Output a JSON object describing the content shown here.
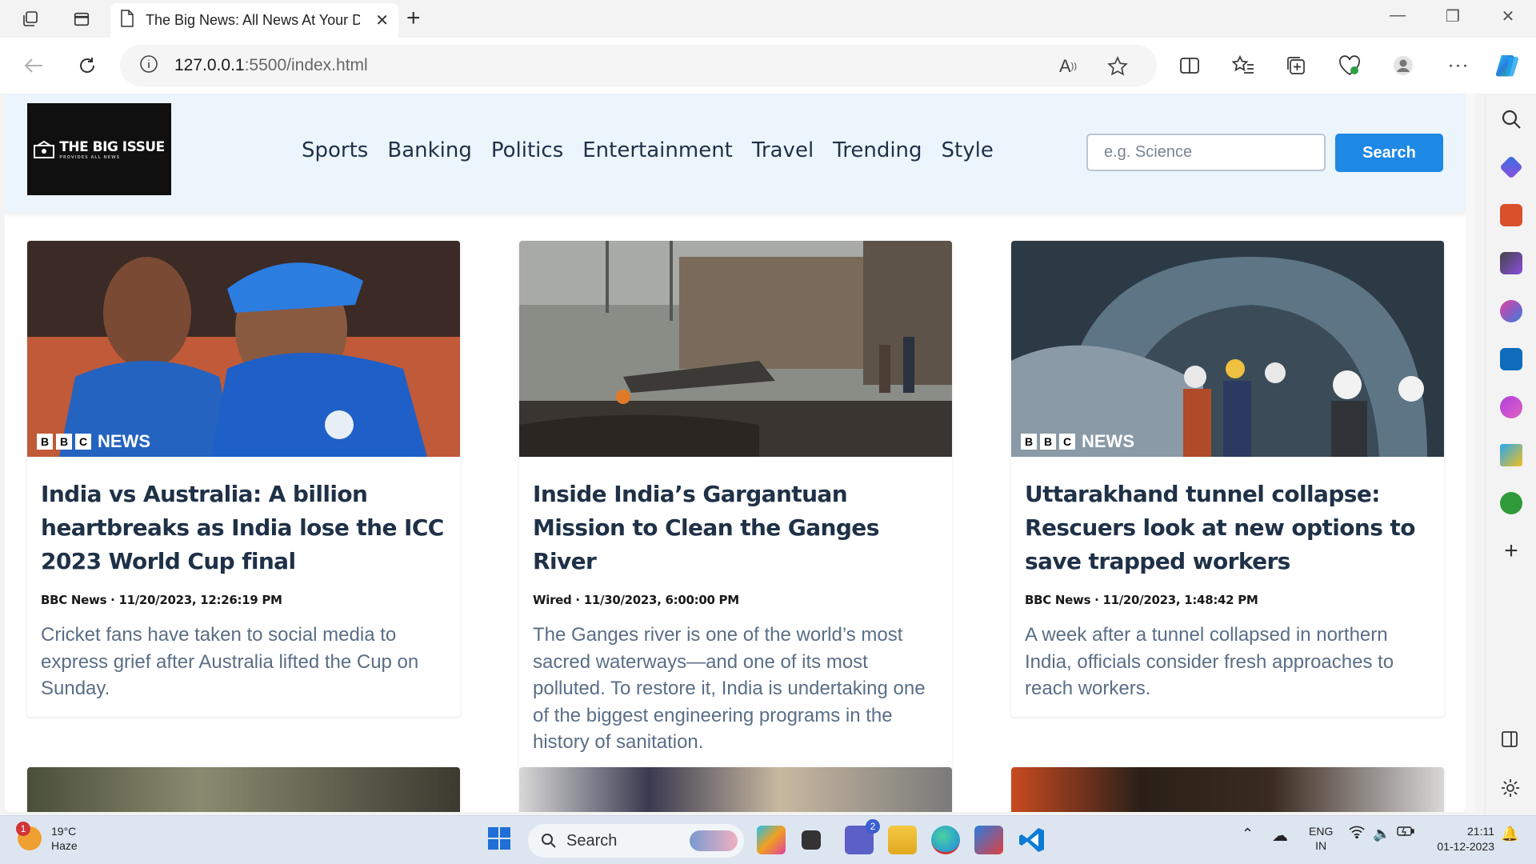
{
  "browser": {
    "tab_title": "The Big News: All News At Your D",
    "url_host": "127.0.0.1",
    "url_rest": ":5500/index.html"
  },
  "site": {
    "logo_text": "THE BIG ISSUE",
    "logo_sub": "PROVIDES ALL NEWS",
    "nav": [
      "Sports",
      "Banking",
      "Politics",
      "Entertainment",
      "Travel",
      "Trending",
      "Style"
    ],
    "search_placeholder": "e.g. Science",
    "search_button": "Search"
  },
  "articles": [
    {
      "title": "India vs Australia: A billion heartbreaks as India lose the ICC 2023 World Cup final",
      "meta": "BBC News · 11/20/2023, 12:26:19 PM",
      "description": "Cricket fans have taken to social media to express grief after Australia lifted the Cup on Sunday.",
      "badge": "NEWS",
      "image_colors": [
        "#2b5fb0",
        "#c2563a",
        "#1d3f86"
      ]
    },
    {
      "title": "Inside India’s Gargantuan Mission to Clean the Ganges River",
      "meta": "Wired · 11/30/2023, 6:00:00 PM",
      "description": "The Ganges river is one of the world’s most sacred waterways—and one of its most polluted. To restore it, India is undertaking one of the biggest engineering programs in the history of sanitation.",
      "badge": "",
      "image_colors": [
        "#9a9a98",
        "#6b6e6a",
        "#3e3b36"
      ]
    },
    {
      "title": "Uttarakhand tunnel collapse: Rescuers look at new options to save trapped workers",
      "meta": "BBC News · 11/20/2023, 1:48:42 PM",
      "description": "A week after a tunnel collapsed in northern India, officials consider fresh approaches to reach workers.",
      "badge": "NEWS",
      "image_colors": [
        "#5d7585",
        "#2c3a46",
        "#8a9aa6"
      ]
    }
  ],
  "taskbar": {
    "temp": "19°C",
    "condition": "Haze",
    "weather_badge": "1",
    "search": "Search",
    "teams_badge": "2",
    "lang1": "ENG",
    "lang2": "IN",
    "time": "21:11",
    "date": "01-12-2023"
  }
}
